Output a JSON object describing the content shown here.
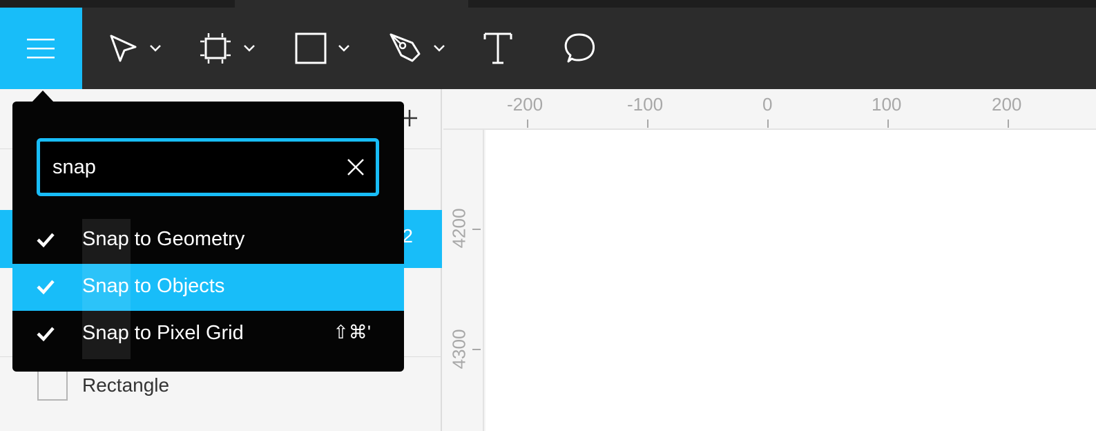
{
  "toolbar": {
    "menu_icon": "hamburger-menu-icon",
    "tools": [
      {
        "name": "move-tool",
        "icon": "cursor-arrow-icon"
      },
      {
        "name": "frame-tool",
        "icon": "frame-icon"
      },
      {
        "name": "shape-tool",
        "icon": "rectangle-icon"
      },
      {
        "name": "pen-tool",
        "icon": "pen-icon"
      },
      {
        "name": "text-tool",
        "icon": "text-icon"
      },
      {
        "name": "comment-tool",
        "icon": "speech-bubble-icon"
      }
    ]
  },
  "layers": {
    "selected_row_suffix": "2",
    "rectangle_label": "Rectangle"
  },
  "ruler": {
    "top_labels": [
      "-200",
      "-100",
      "0",
      "100",
      "200"
    ],
    "left_labels": [
      "4200",
      "4300"
    ]
  },
  "quick_actions": {
    "search_value": "snap",
    "results": [
      {
        "label": "Snap to Geometry",
        "checked": true,
        "shortcut": ""
      },
      {
        "label": "Snap to Objects",
        "checked": true,
        "shortcut": ""
      },
      {
        "label": "Snap to Pixel Grid",
        "checked": true,
        "shortcut": "⇧⌘'"
      }
    ]
  },
  "colors": {
    "accent": "#18bdf9",
    "toolbar_bg": "#2c2c2c",
    "popover_bg": "#050505"
  }
}
